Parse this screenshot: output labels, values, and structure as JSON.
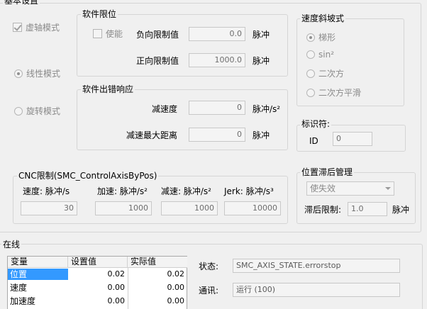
{
  "basic": {
    "title": "基本设置",
    "virtual_axis": "虚轴模式",
    "linear_mode": "线性模式",
    "rotary_mode": "旋转模式"
  },
  "soft_limit": {
    "title": "软件限位",
    "enable": "使能",
    "neg_label": "负向限制值",
    "neg_value": "0.0",
    "neg_unit": "脉冲",
    "pos_label": "正向限制值",
    "pos_value": "1000.0",
    "pos_unit": "脉冲"
  },
  "soft_error": {
    "title": "软件出错响应",
    "decel_label": "减速度",
    "decel_value": "0",
    "decel_unit": "脉冲/s²",
    "maxdist_label": "减速最大距离",
    "maxdist_value": "0",
    "maxdist_unit": "脉冲"
  },
  "ramp": {
    "title": "速度斜坡式",
    "options": [
      "梯形",
      "sin²",
      "二次方",
      "二次方平滑"
    ]
  },
  "identifier": {
    "title": "标识符:",
    "id_label": "ID",
    "id_value": "0"
  },
  "cnc": {
    "title": "CNC限制(SMC_ControlAxisByPos)",
    "speed_label": "速度:",
    "speed_unit": "脉冲/s",
    "speed_value": "30",
    "accel_label": "加速:",
    "accel_unit": "脉冲/s²",
    "accel_value": "1000",
    "decel_label": "减速:",
    "decel_unit": "脉冲/s²",
    "decel_value": "1000",
    "jerk_label": "Jerk:",
    "jerk_unit": "脉冲/s³",
    "jerk_value": "10000"
  },
  "lag": {
    "title": "位置滞后管理",
    "select_value": "使失效",
    "limit_label": "滞后限制:",
    "limit_value": "1.0",
    "limit_unit": "脉冲"
  },
  "online": {
    "title": "在线",
    "columns": [
      "变量",
      "设置值",
      "实际值"
    ],
    "rows": [
      {
        "name": "位置",
        "set": "0.02",
        "actual": "0.02"
      },
      {
        "name": "速度",
        "set": "0.00",
        "actual": "0.00"
      },
      {
        "name": "加速度",
        "set": "0.00",
        "actual": "0.00"
      }
    ],
    "state_label": "状态:",
    "state_value": "SMC_AXIS_STATE.errorstop",
    "comm_label": "通讯:",
    "comm_value": "运行 (100)"
  }
}
